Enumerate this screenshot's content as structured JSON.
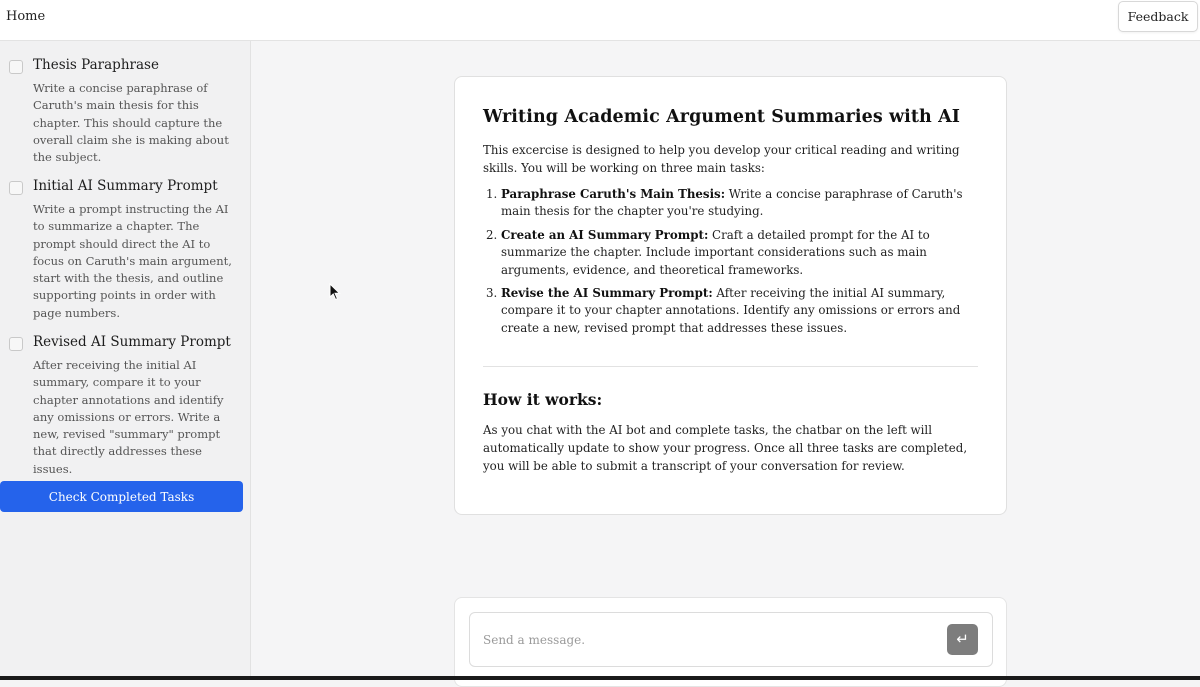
{
  "topbar": {
    "home_label": "Home",
    "feedback_label": "Feedback"
  },
  "sidebar": {
    "tasks": [
      {
        "title": "Thesis Paraphrase",
        "description": "Write a concise paraphrase of Caruth's main thesis for this chapter. This should capture the overall claim she is making about the subject.",
        "completed": false
      },
      {
        "title": "Initial AI Summary Prompt",
        "description": "Write a prompt instructing the AI to summarize a chapter. The prompt should direct the AI to focus on Caruth's main argument, start with the thesis, and outline supporting points in order with page numbers.",
        "completed": false
      },
      {
        "title": "Revised AI Summary Prompt",
        "description": "After receiving the initial AI summary, compare it to your chapter annotations and identify any omissions or errors. Write a new, revised \"summary\" prompt that directly addresses these issues.",
        "completed": false
      }
    ],
    "check_button_label": "Check Completed Tasks"
  },
  "card": {
    "title": "Writing Academic Argument Summaries with AI",
    "intro": "This excercise is designed to help you develop your critical reading and writing skills. You will be working on three main tasks:",
    "steps": [
      {
        "heading": "Paraphrase Caruth's Main Thesis:",
        "text": " Write a concise paraphrase of Caruth's main thesis for the chapter you're studying."
      },
      {
        "heading": "Create an AI Summary Prompt:",
        "text": " Craft a detailed prompt for the AI to summarize the chapter. Include important considerations such as main arguments, evidence, and theoretical frameworks."
      },
      {
        "heading": "Revise the AI Summary Prompt:",
        "text": " After receiving the initial AI summary, compare it to your chapter annotations. Identify any omissions or errors and create a new, revised prompt that addresses these issues."
      }
    ],
    "how_title": "How it works:",
    "how_text": "As you chat with the AI bot and complete tasks, the chatbar on the left will automatically update to show your progress. Once all three tasks are completed, you will be able to submit a transcript of your conversation for review."
  },
  "composer": {
    "placeholder": "Send a message.",
    "value": "",
    "send_icon": "enter-icon"
  },
  "colors": {
    "accent": "#2563eb",
    "send_button": "#7d7d7d"
  }
}
